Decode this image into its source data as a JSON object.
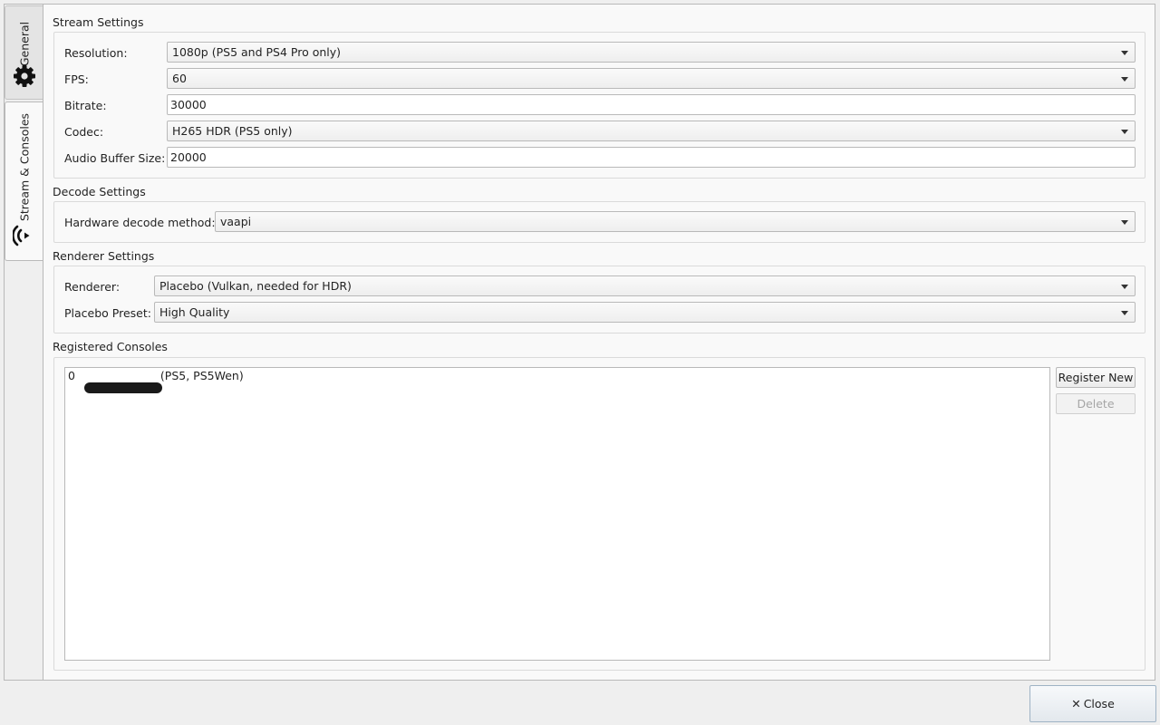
{
  "tabs": [
    {
      "label": "General",
      "icon": "gear-icon"
    },
    {
      "label": "Stream & Consoles",
      "icon": "wireless-signal-icon"
    }
  ],
  "stream_settings": {
    "title": "Stream Settings",
    "resolution": {
      "label": "Resolution:",
      "value": "1080p (PS5 and PS4 Pro only)"
    },
    "fps": {
      "label": "FPS:",
      "value": "60"
    },
    "bitrate": {
      "label": "Bitrate:",
      "value": "30000"
    },
    "codec": {
      "label": "Codec:",
      "value": "H265 HDR (PS5 only)"
    },
    "audio_buffer": {
      "label": "Audio Buffer Size:",
      "value": "20000"
    }
  },
  "decode_settings": {
    "title": "Decode Settings",
    "hw_decode": {
      "label": "Hardware decode method:",
      "value": "vaapi"
    }
  },
  "renderer_settings": {
    "title": "Renderer Settings",
    "renderer": {
      "label": "Renderer:",
      "value": "Placebo (Vulkan, needed for HDR)"
    },
    "preset": {
      "label": "Placebo Preset:",
      "value": "High Quality"
    }
  },
  "registered_consoles": {
    "title": "Registered Consoles",
    "items": [
      {
        "prefix": "0",
        "suffix": " (PS5, PS5Wen)"
      }
    ],
    "register_label": "Register New",
    "delete_label": "Delete"
  },
  "close_label": "Close"
}
